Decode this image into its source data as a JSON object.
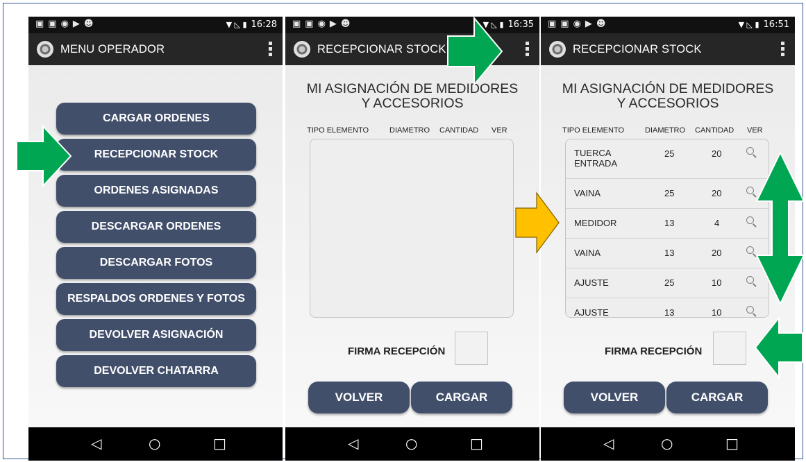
{
  "status_bar": {
    "icons": [
      "notification-icon",
      "image-icon",
      "shield-icon",
      "play-store-icon",
      "android-icon"
    ],
    "times": [
      "16:28",
      "16:35",
      "16:51"
    ]
  },
  "screen1": {
    "title": "MENU OPERADOR",
    "buttons": [
      "CARGAR ORDENES",
      "RECEPCIONAR STOCK",
      "ORDENES ASIGNADAS",
      "DESCARGAR ORDENES",
      "DESCARGAR FOTOS",
      "RESPALDOS ORDENES Y FOTOS",
      "DEVOLVER ASIGNACIÓN",
      "DEVOLVER CHATARRA"
    ]
  },
  "screen2": {
    "title": "RECEPCIONAR STOCK",
    "heading_line1": "MI ASIGNACIÓN DE MEDIDORES",
    "heading_line2": "Y ACCESORIOS",
    "columns": [
      "TIPO ELEMENTO",
      "DIAMETRO",
      "CANTIDAD",
      "VER"
    ],
    "firma_label": "FIRMA RECEPCIÓN",
    "volver": "VOLVER",
    "cargar": "CARGAR"
  },
  "screen3": {
    "title": "RECEPCIONAR STOCK",
    "heading_line1": "MI ASIGNACIÓN DE MEDIDORES",
    "heading_line2": "Y ACCESORIOS",
    "columns": [
      "TIPO ELEMENTO",
      "DIAMETRO",
      "CANTIDAD",
      "VER"
    ],
    "rows": [
      {
        "tipo": "TUERCA ENTRADA",
        "diametro": "25",
        "cantidad": "20"
      },
      {
        "tipo": "VAINA",
        "diametro": "25",
        "cantidad": "20"
      },
      {
        "tipo": "MEDIDOR",
        "diametro": "13",
        "cantidad": "4"
      },
      {
        "tipo": "VAINA",
        "diametro": "13",
        "cantidad": "20"
      },
      {
        "tipo": "AJUSTE",
        "diametro": "25",
        "cantidad": "10"
      },
      {
        "tipo": "AJUSTE",
        "diametro": "13",
        "cantidad": "10"
      }
    ],
    "firma_label": "FIRMA RECEPCIÓN",
    "volver": "VOLVER",
    "cargar": "CARGAR"
  },
  "colors": {
    "button": "#414f6b",
    "annotation_green": "#00a651",
    "annotation_yellow": "#ffc000",
    "frame_border": "#2f5597"
  }
}
